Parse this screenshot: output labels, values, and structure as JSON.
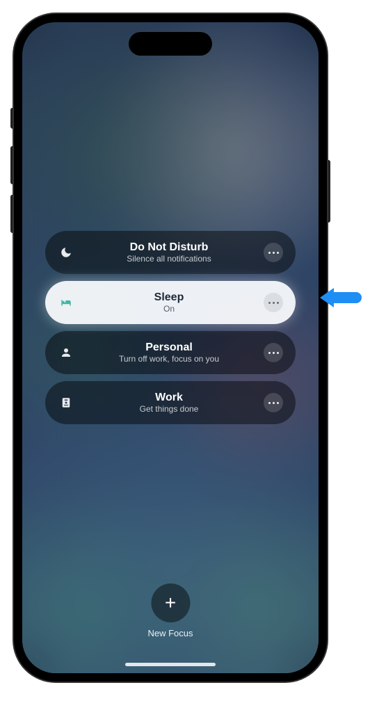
{
  "focus_items": [
    {
      "title": "Do Not Disturb",
      "subtitle": "Silence all notifications",
      "active": false,
      "icon": "moon-icon"
    },
    {
      "title": "Sleep",
      "subtitle": "On",
      "active": true,
      "icon": "bed-icon"
    },
    {
      "title": "Personal",
      "subtitle": "Turn off work, focus on you",
      "active": false,
      "icon": "person-icon"
    },
    {
      "title": "Work",
      "subtitle": "Get things done",
      "active": false,
      "icon": "badge-icon"
    }
  ],
  "new_focus_label": "New Focus",
  "annotation": {
    "target_index": 1
  }
}
